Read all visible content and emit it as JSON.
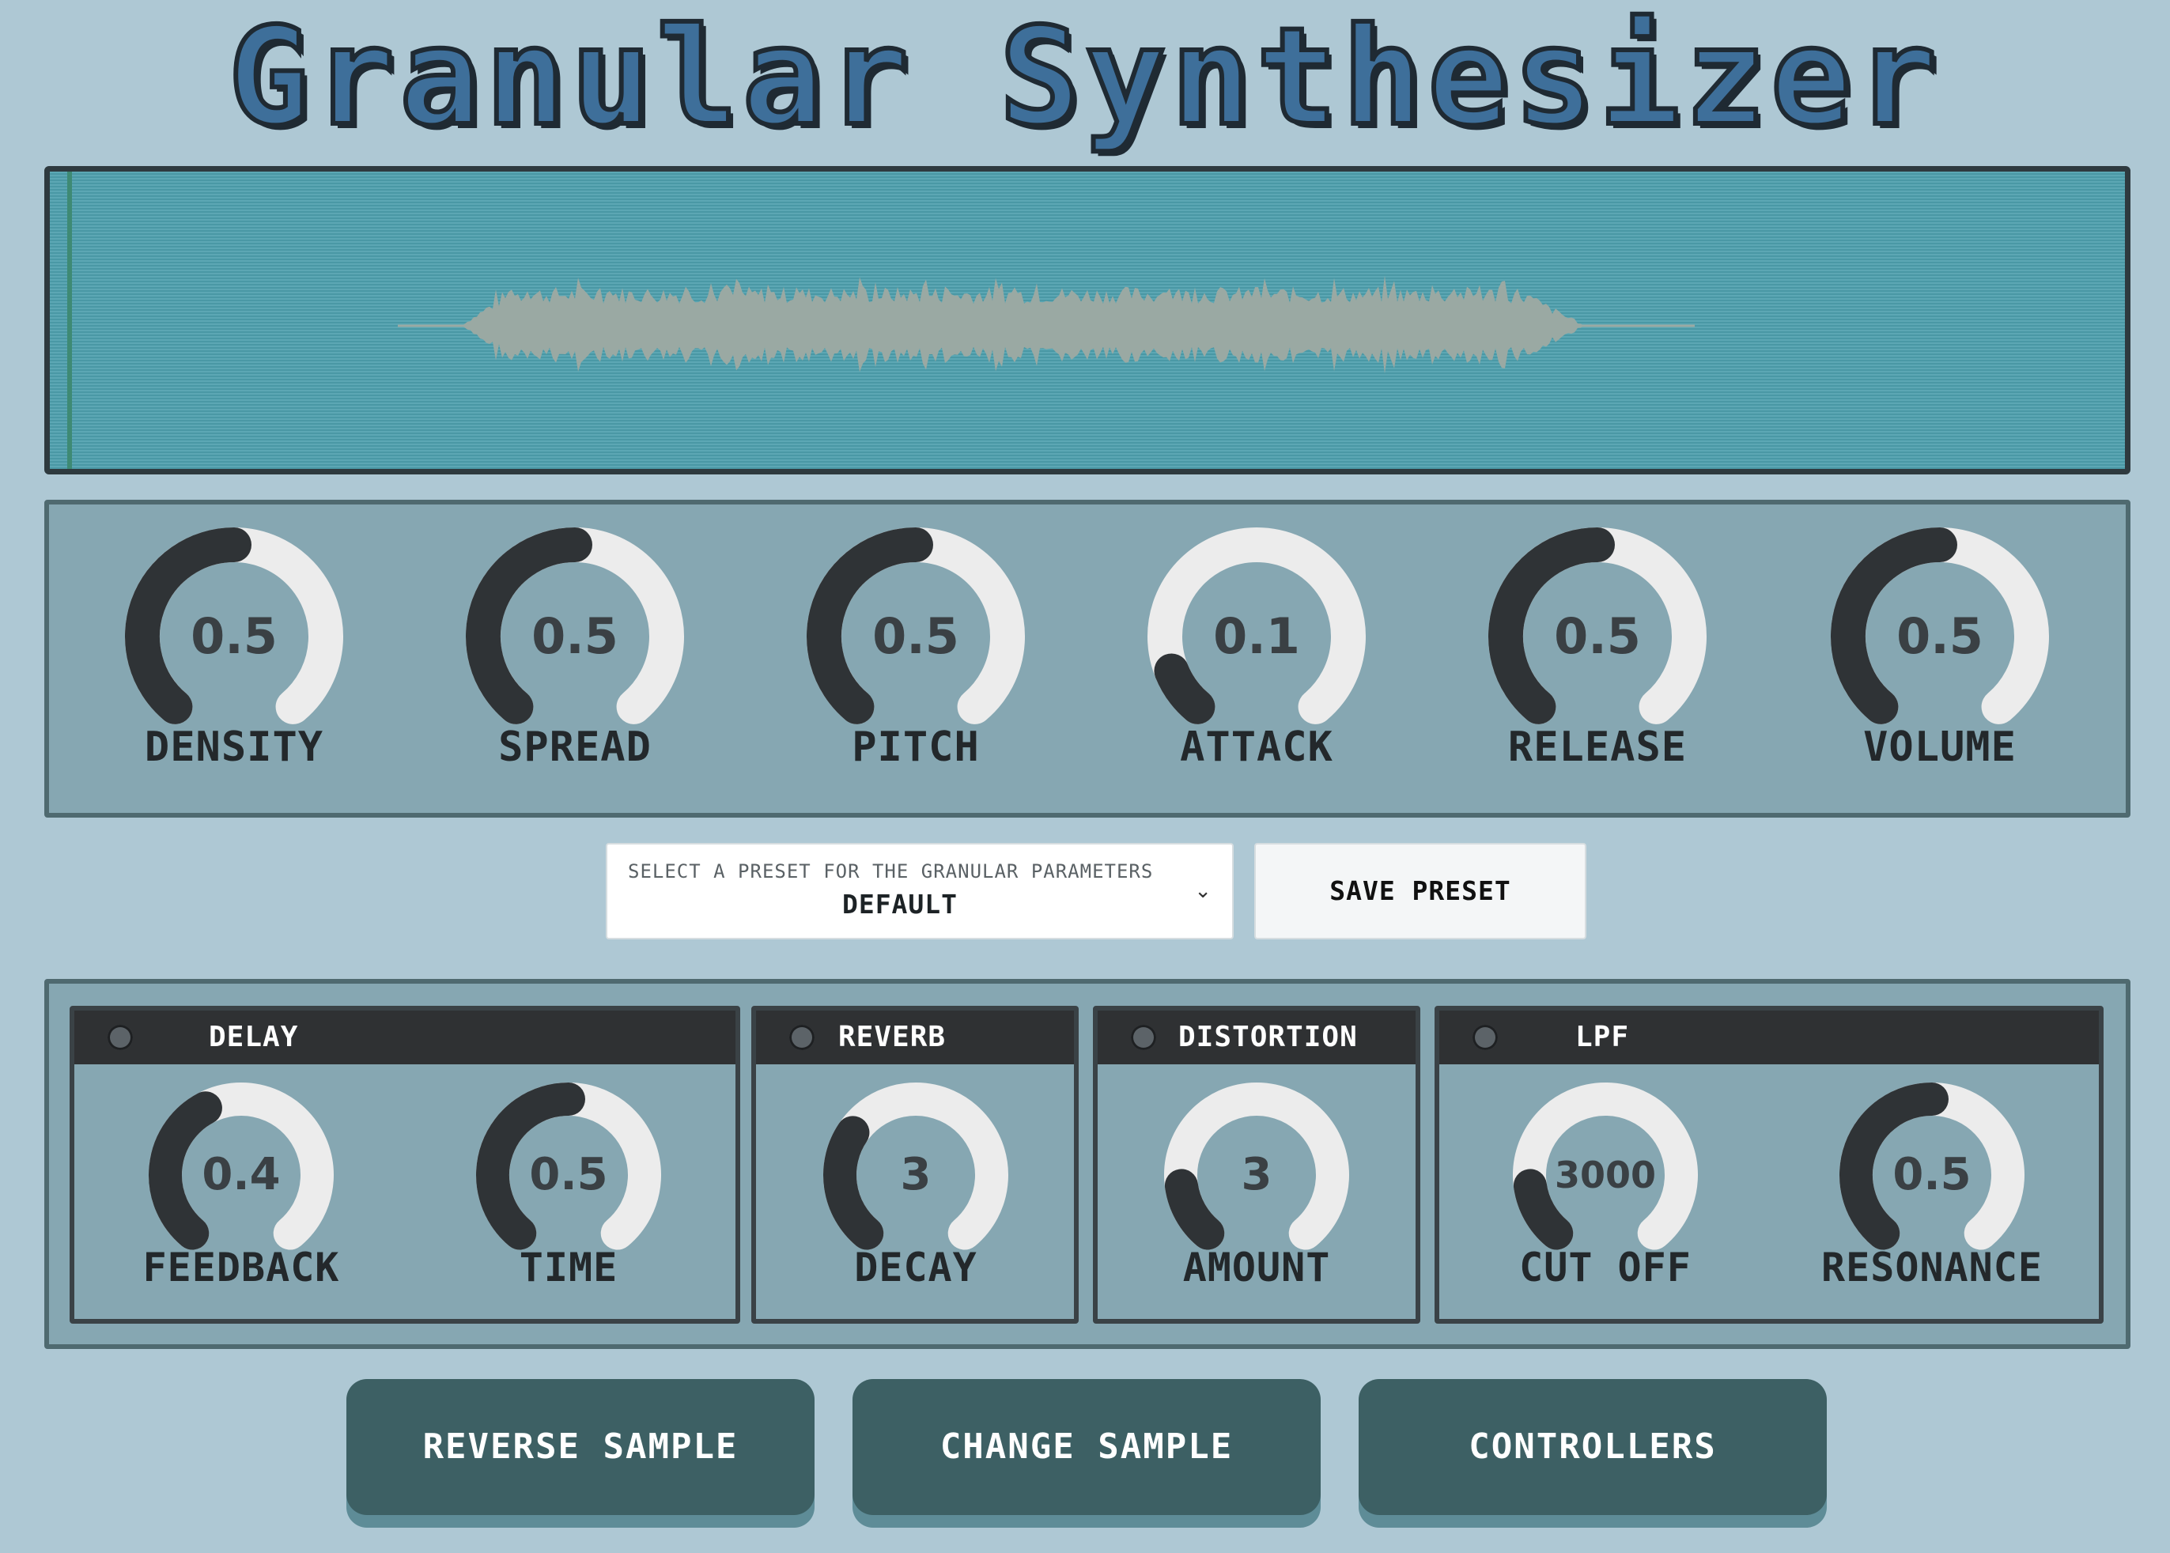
{
  "title": "Granular Synthesizer",
  "colors": {
    "background": "#aec8d4",
    "panel": "#86a7b2",
    "waveform_bg": "#4ea0ae",
    "waveform": "#9aa9a3",
    "knob_fill": "#2f3336",
    "knob_track": "#ececec",
    "button": "#3d6064"
  },
  "granular_knobs": [
    {
      "label": "DENSITY",
      "display": "0.5",
      "level": 0.5
    },
    {
      "label": "SPREAD",
      "display": "0.5",
      "level": 0.5
    },
    {
      "label": "PITCH",
      "display": "0.5",
      "level": 0.5
    },
    {
      "label": "ATTACK",
      "display": "0.1",
      "level": 0.1
    },
    {
      "label": "RELEASE",
      "display": "0.5",
      "level": 0.5
    },
    {
      "label": "VOLUME",
      "display": "0.5",
      "level": 0.5
    }
  ],
  "preset": {
    "label": "SELECT A PRESET FOR THE GRANULAR PARAMETERS",
    "value": "DEFAULT",
    "chevron_icon": "chevron-down-icon",
    "save_label": "SAVE PRESET"
  },
  "effects": [
    {
      "name": "DELAY",
      "enabled": false,
      "knobs": [
        {
          "label": "FEEDBACK",
          "display": "0.4",
          "level": 0.4
        },
        {
          "label": "TIME",
          "display": "0.5",
          "level": 0.5
        }
      ]
    },
    {
      "name": "REVERB",
      "enabled": false,
      "knobs": [
        {
          "label": "DECAY",
          "display": "3",
          "level": 0.3
        }
      ]
    },
    {
      "name": "DISTORTION",
      "enabled": false,
      "knobs": [
        {
          "label": "AMOUNT",
          "display": "3",
          "level": 0.15
        }
      ]
    },
    {
      "name": "LPF",
      "enabled": false,
      "knobs": [
        {
          "label": "CUT OFF",
          "display": "3000",
          "level": 0.15
        },
        {
          "label": "RESONANCE",
          "display": "0.5",
          "level": 0.5
        }
      ]
    }
  ],
  "buttons": {
    "reverse": "REVERSE SAMPLE",
    "change": "CHANGE SAMPLE",
    "controllers": "CONTROLLERS"
  }
}
